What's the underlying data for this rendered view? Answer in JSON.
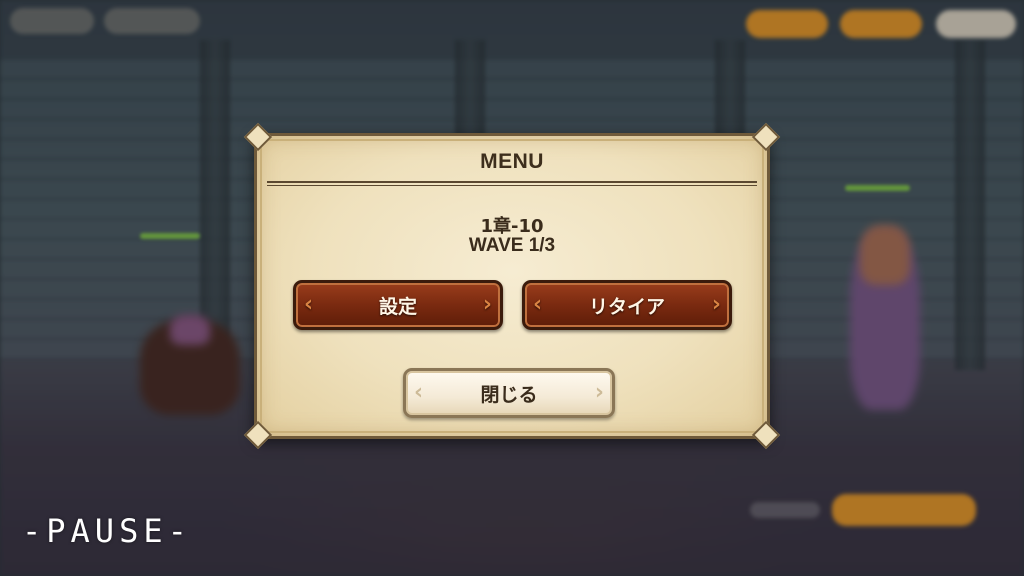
{
  "menu": {
    "title": "MENU",
    "stage_name": "1章-10",
    "wave": "WAVE 1/3",
    "buttons": {
      "settings": "設定",
      "retire": "リタイア",
      "close": "閉じる"
    }
  },
  "overlay": {
    "pause_label": "-PAUSE-"
  },
  "colors": {
    "primary_button": "#7a2a10",
    "secondary_button": "#f4ead6",
    "dialog_background": "#efe1bd",
    "hud_accent": "#e0962e"
  }
}
